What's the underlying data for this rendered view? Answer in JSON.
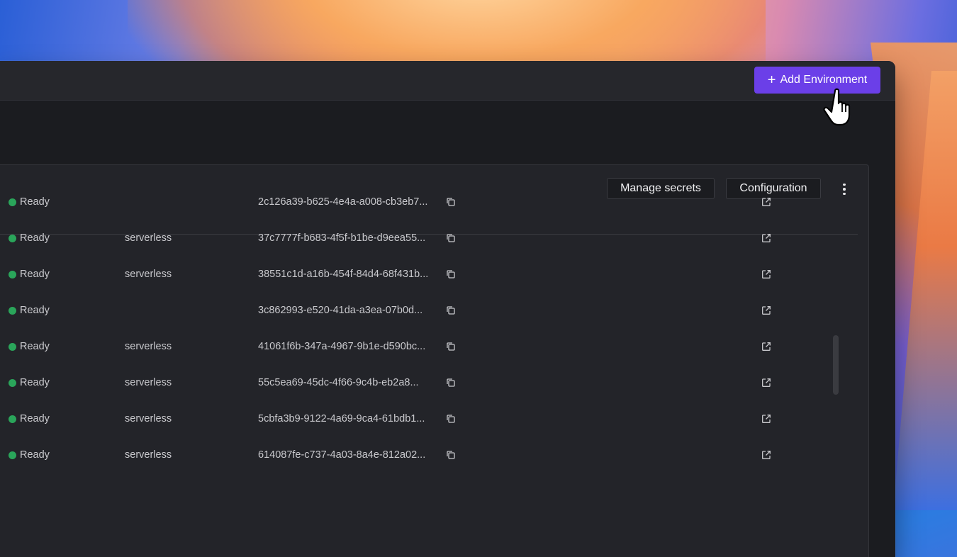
{
  "header": {
    "add_environment_label": "Add Environment"
  },
  "toolbar": {
    "manage_secrets_label": "Manage secrets",
    "configuration_label": "Configuration"
  },
  "rows": [
    {
      "status": "Ready",
      "type": "",
      "id": "2c126a39-b625-4e4a-a008-cb3eb7..."
    },
    {
      "status": "Ready",
      "type": "serverless",
      "id": "37c7777f-b683-4f5f-b1be-d9eea55..."
    },
    {
      "status": "Ready",
      "type": "serverless",
      "id": "38551c1d-a16b-454f-84d4-68f431b..."
    },
    {
      "status": "Ready",
      "type": "",
      "id": "3c862993-e520-41da-a3ea-07b0d..."
    },
    {
      "status": "Ready",
      "type": "serverless",
      "id": "41061f6b-347a-4967-9b1e-d590bc..."
    },
    {
      "status": "Ready",
      "type": "serverless",
      "id": "55c5ea69-45dc-4f66-9c4b-eb2a8..."
    },
    {
      "status": "Ready",
      "type": "serverless",
      "id": "5cbfa3b9-9122-4a69-9ca4-61bdb1..."
    },
    {
      "status": "Ready",
      "type": "serverless",
      "id": "614087fe-c737-4a03-8a4e-812a02..."
    }
  ],
  "colors": {
    "accent": "#6b3fe8",
    "status_ready": "#2aa55a",
    "background": "#1b1c20"
  },
  "icons": {
    "copy": "copy-icon",
    "external_link": "external-link-icon",
    "more": "kebab-menu-icon",
    "plus": "plus-icon"
  }
}
